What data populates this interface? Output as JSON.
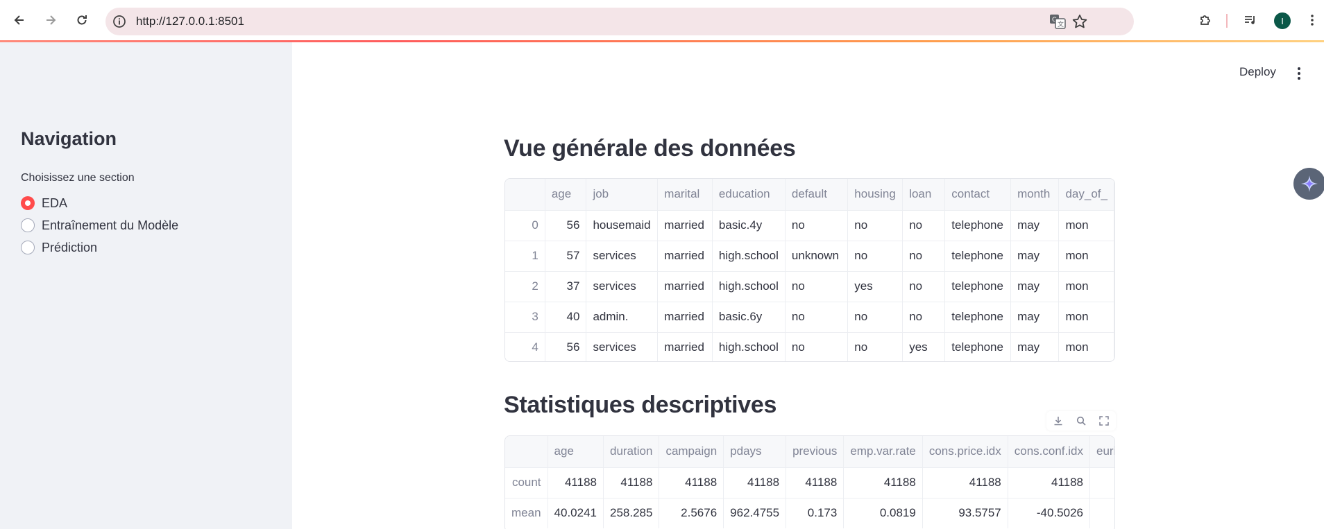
{
  "browser": {
    "url": "http://127.0.0.1:8501",
    "profile_initial": "I"
  },
  "sidebar": {
    "title": "Navigation",
    "radio_label": "Choisissez une section",
    "options": [
      {
        "label": "EDA",
        "selected": true
      },
      {
        "label": "Entraînement du Modèle",
        "selected": false
      },
      {
        "label": "Prédiction",
        "selected": false
      }
    ]
  },
  "header": {
    "deploy_label": "Deploy"
  },
  "overview": {
    "title": "Vue générale des données",
    "columns": [
      "",
      "age",
      "job",
      "marital",
      "education",
      "default",
      "housing",
      "loan",
      "contact",
      "month",
      "day_of_"
    ],
    "rows": [
      [
        "0",
        "56",
        "housemaid",
        "married",
        "basic.4y",
        "no",
        "no",
        "no",
        "telephone",
        "may",
        "mon"
      ],
      [
        "1",
        "57",
        "services",
        "married",
        "high.school",
        "unknown",
        "no",
        "no",
        "telephone",
        "may",
        "mon"
      ],
      [
        "2",
        "37",
        "services",
        "married",
        "high.school",
        "no",
        "yes",
        "no",
        "telephone",
        "may",
        "mon"
      ],
      [
        "3",
        "40",
        "admin.",
        "married",
        "basic.6y",
        "no",
        "no",
        "no",
        "telephone",
        "may",
        "mon"
      ],
      [
        "4",
        "56",
        "services",
        "married",
        "high.school",
        "no",
        "no",
        "yes",
        "telephone",
        "may",
        "mon"
      ]
    ]
  },
  "stats": {
    "title": "Statistiques descriptives",
    "columns": [
      "",
      "age",
      "duration",
      "campaign",
      "pdays",
      "previous",
      "emp.var.rate",
      "cons.price.idx",
      "cons.conf.idx",
      "euri"
    ],
    "rows": [
      [
        "count",
        "41188",
        "41188",
        "41188",
        "41188",
        "41188",
        "41188",
        "41188",
        "41188",
        ""
      ],
      [
        "mean",
        "40.0241",
        "258.285",
        "2.5676",
        "962.4755",
        "0.173",
        "0.0819",
        "93.5757",
        "-40.5026",
        ""
      ]
    ]
  },
  "colors": {
    "accent": "#ff4b4b",
    "sidebar_bg": "#f0f2f6",
    "text": "#31333f"
  }
}
